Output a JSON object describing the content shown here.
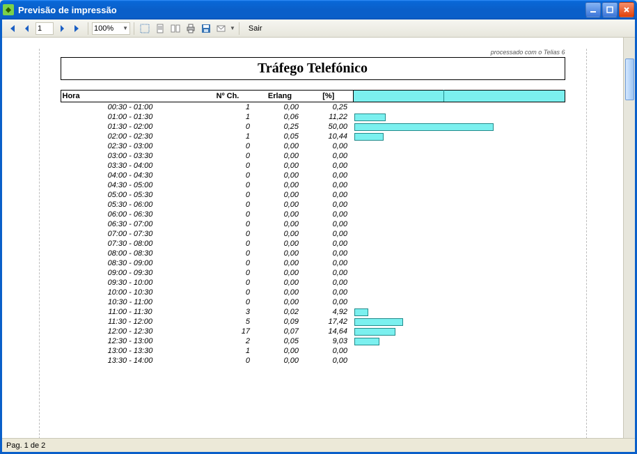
{
  "window": {
    "title": "Previsão de impressão"
  },
  "toolbar": {
    "page_value": "1",
    "zoom_value": "100%",
    "exit_label": "Sair"
  },
  "report": {
    "processed_label": "processado com o Telias 6",
    "title": "Tráfego Telefónico",
    "headers": {
      "hora": "Hora",
      "nch": "Nº Ch.",
      "erlang": "Erlang",
      "pct": "[%]"
    }
  },
  "status": {
    "page_label": "Pag. 1 de 2"
  },
  "chart_data": {
    "type": "bar",
    "title": "Tráfego Telefónico",
    "xlabel": "[%]",
    "ylabel": "Hora",
    "columns": [
      "Hora",
      "Nº Ch.",
      "Erlang",
      "[%]"
    ],
    "rows": [
      {
        "hora": "00:30 - 01:00",
        "nch": 1,
        "erlang": "0,00",
        "pct": "0,25",
        "pctv": 0.25
      },
      {
        "hora": "01:00 - 01:30",
        "nch": 1,
        "erlang": "0,06",
        "pct": "11,22",
        "pctv": 11.22
      },
      {
        "hora": "01:30 - 02:00",
        "nch": 0,
        "erlang": "0,25",
        "pct": "50,00",
        "pctv": 50.0
      },
      {
        "hora": "02:00 - 02:30",
        "nch": 1,
        "erlang": "0,05",
        "pct": "10,44",
        "pctv": 10.44
      },
      {
        "hora": "02:30 - 03:00",
        "nch": 0,
        "erlang": "0,00",
        "pct": "0,00",
        "pctv": 0
      },
      {
        "hora": "03:00 - 03:30",
        "nch": 0,
        "erlang": "0,00",
        "pct": "0,00",
        "pctv": 0
      },
      {
        "hora": "03:30 - 04:00",
        "nch": 0,
        "erlang": "0,00",
        "pct": "0,00",
        "pctv": 0
      },
      {
        "hora": "04:00 - 04:30",
        "nch": 0,
        "erlang": "0,00",
        "pct": "0,00",
        "pctv": 0
      },
      {
        "hora": "04:30 - 05:00",
        "nch": 0,
        "erlang": "0,00",
        "pct": "0,00",
        "pctv": 0
      },
      {
        "hora": "05:00 - 05:30",
        "nch": 0,
        "erlang": "0,00",
        "pct": "0,00",
        "pctv": 0
      },
      {
        "hora": "05:30 - 06:00",
        "nch": 0,
        "erlang": "0,00",
        "pct": "0,00",
        "pctv": 0
      },
      {
        "hora": "06:00 - 06:30",
        "nch": 0,
        "erlang": "0,00",
        "pct": "0,00",
        "pctv": 0
      },
      {
        "hora": "06:30 - 07:00",
        "nch": 0,
        "erlang": "0,00",
        "pct": "0,00",
        "pctv": 0
      },
      {
        "hora": "07:00 - 07:30",
        "nch": 0,
        "erlang": "0,00",
        "pct": "0,00",
        "pctv": 0
      },
      {
        "hora": "07:30 - 08:00",
        "nch": 0,
        "erlang": "0,00",
        "pct": "0,00",
        "pctv": 0
      },
      {
        "hora": "08:00 - 08:30",
        "nch": 0,
        "erlang": "0,00",
        "pct": "0,00",
        "pctv": 0
      },
      {
        "hora": "08:30 - 09:00",
        "nch": 0,
        "erlang": "0,00",
        "pct": "0,00",
        "pctv": 0
      },
      {
        "hora": "09:00 - 09:30",
        "nch": 0,
        "erlang": "0,00",
        "pct": "0,00",
        "pctv": 0
      },
      {
        "hora": "09:30 - 10:00",
        "nch": 0,
        "erlang": "0,00",
        "pct": "0,00",
        "pctv": 0
      },
      {
        "hora": "10:00 - 10:30",
        "nch": 0,
        "erlang": "0,00",
        "pct": "0,00",
        "pctv": 0
      },
      {
        "hora": "10:30 - 11:00",
        "nch": 0,
        "erlang": "0,00",
        "pct": "0,00",
        "pctv": 0
      },
      {
        "hora": "11:00 - 11:30",
        "nch": 3,
        "erlang": "0,02",
        "pct": "4,92",
        "pctv": 4.92
      },
      {
        "hora": "11:30 - 12:00",
        "nch": 5,
        "erlang": "0,09",
        "pct": "17,42",
        "pctv": 17.42
      },
      {
        "hora": "12:00 - 12:30",
        "nch": 17,
        "erlang": "0,07",
        "pct": "14,64",
        "pctv": 14.64
      },
      {
        "hora": "12:30 - 13:00",
        "nch": 2,
        "erlang": "0,05",
        "pct": "9,03",
        "pctv": 9.03
      },
      {
        "hora": "13:00 - 13:30",
        "nch": 1,
        "erlang": "0,00",
        "pct": "0,00",
        "pctv": 0
      },
      {
        "hora": "13:30 - 14:00",
        "nch": 0,
        "erlang": "0,00",
        "pct": "0,00",
        "pctv": 0
      }
    ],
    "xlim": [
      0,
      50
    ]
  }
}
